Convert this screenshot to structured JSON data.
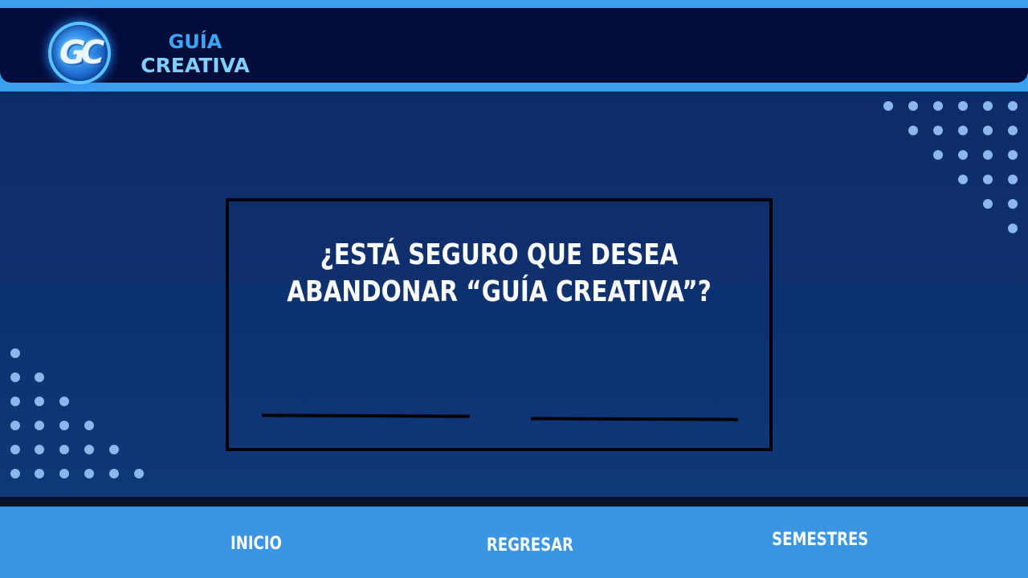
{
  "header": {
    "logo_initials": "GC",
    "brand_line1": "GUÍA",
    "brand_line2": "CREATIVA"
  },
  "dialog": {
    "question_line1": "¿ESTÁ SEGURO QUE DESEA",
    "question_line2": "ABANDONAR “GUÍA CREATIVA”?"
  },
  "nav": {
    "inicio": "INICIO",
    "regresar": "REGRESAR",
    "semestres": "SEMESTRES"
  },
  "colors": {
    "background": "#0e3270",
    "header_bar": "#020d3a",
    "accent": "#3aa0f0",
    "footer": "#3a95e2",
    "dots": "#8db6ea"
  },
  "icons": [
    "gc-logo-icon"
  ]
}
